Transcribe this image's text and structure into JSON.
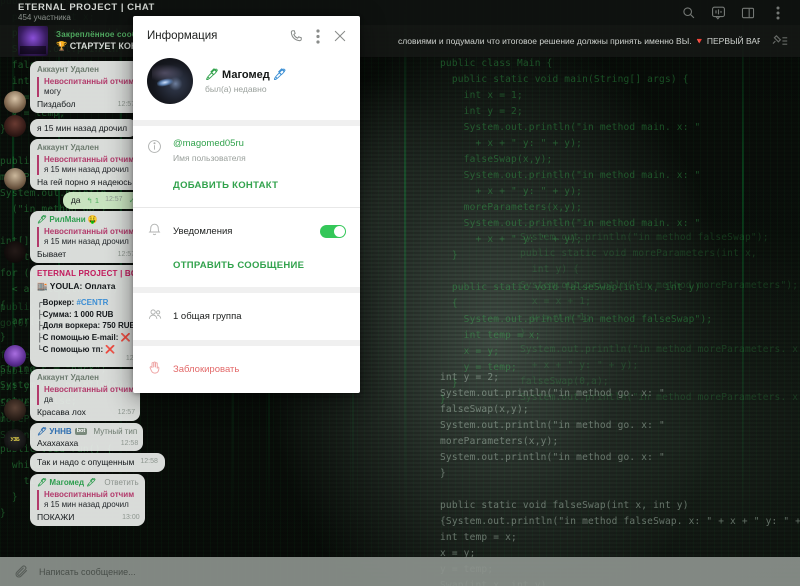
{
  "header": {
    "title": "ETERNAL PROJECT | CHAT",
    "subtitle": "454 участника",
    "icons": [
      {
        "name": "search-icon"
      },
      {
        "name": "voice-chat-icon"
      },
      {
        "name": "split-view-icon"
      },
      {
        "name": "more-options-icon"
      }
    ]
  },
  "pinned": {
    "label": "Закреплённое сообщение",
    "text": "🏆 СТАРТУЕТ КОНКУРС НА",
    "overflow_text": "словиями и подумали что итоговое решение должны принять именно ВЫ. 🔻 ПЕРВЫЙ ВАРИАНТ",
    "pin_icon": "pinned-messages-icon"
  },
  "messages": [
    {
      "id": "m1",
      "sender": "Аккаунт Удален",
      "sender_color": "grey",
      "quote_name": "Невоспитанный отчим",
      "quote_text": "могу",
      "text": "Пиздабол",
      "time": "12:57",
      "avatar": "a1",
      "out": false
    },
    {
      "id": "m2",
      "sender": "",
      "sender_color": "grey",
      "quote_name": "",
      "quote_text": "",
      "text": "я 15 мин назад дрочил",
      "time": "",
      "avatar": "a2",
      "out": false
    },
    {
      "id": "m3",
      "sender": "Аккаунт Удален",
      "sender_color": "grey",
      "quote_name": "Невоспитанный отчим",
      "quote_text": "я 15 мин назад дрочил",
      "text": "На гей порно я надеюсь",
      "time": "",
      "avatar": "a3",
      "out": false
    },
    {
      "id": "m4",
      "sender": "",
      "sender_color": "grey",
      "quote_name": "",
      "quote_text": "",
      "text": "да",
      "time": "12:57",
      "reply_count": "1",
      "checks": "✓✓",
      "avatar": "",
      "out": true
    },
    {
      "id": "m5",
      "sender": "🖊 РилМани 🤑",
      "sender_color": "green",
      "quote_name": "Невоспитанный отчим",
      "quote_text": "я 15 мин назад дрочил",
      "text": "Бывает",
      "time": "12:57",
      "avatar": "a4",
      "out": false
    },
    {
      "id": "m6",
      "bot": true,
      "bot_title": "ETERNAL PROJECT | BOT",
      "bot_sub": "🏬 YOULA: Оплата",
      "bot_lines": [
        {
          "prefix": "┌Воркер: ",
          "value": "#CENTR",
          "highlight": true
        },
        {
          "prefix": "├Сумма: ",
          "value": "1 000 RUB",
          "highlight": false
        },
        {
          "prefix": "├Доля воркера: ",
          "value": "750 RUB",
          "highlight": false
        },
        {
          "prefix": "├С помощью E-mail: ",
          "value": "❌",
          "highlight": false
        },
        {
          "prefix": "└С помощью тп: ",
          "value": "❌",
          "highlight": false
        }
      ],
      "time": "12:57",
      "avatar": "a5",
      "out": false
    },
    {
      "id": "m7",
      "sender": "Аккаунт Удален",
      "sender_color": "grey",
      "quote_name": "Невоспитанный отчим",
      "quote_text": "да",
      "text": "Красава лох",
      "time": "12:57",
      "avatar": "a6",
      "out": false
    },
    {
      "id": "m8",
      "sender": "🖊 УННВ",
      "sender_badge": "bot",
      "sender_color": "blue",
      "sender_suffix": "Мутный тип",
      "quote_name": "",
      "quote_text": "",
      "text": "Ахахахаха",
      "time": "12:58",
      "avatar": "a7",
      "out": false
    },
    {
      "id": "m9",
      "sender": "",
      "sender_color": "grey",
      "quote_name": "",
      "quote_text": "",
      "text": "Так и надо с опущенным",
      "time": "12:58",
      "avatar": "",
      "out": false
    },
    {
      "id": "m10",
      "sender": "🖊 Магомед 🖊",
      "sender_color": "green",
      "sender_action": "Ответить",
      "quote_name": "Невоспитанный отчим",
      "quote_text": "я 15 мин назад дрочил",
      "text": "ПОКАЖИ",
      "time": "13:00",
      "avatar": "",
      "out": false
    }
  ],
  "composer": {
    "attach_icon": "paperclip-icon",
    "placeholder": "Написать сообщение..."
  },
  "dialog": {
    "title": "Информация",
    "call_icon": "phone-call-icon",
    "menu_icon": "more-vertical-icon",
    "close_icon": "close-icon",
    "profile": {
      "avatar_name": "user-avatar",
      "name": "Магомед",
      "emoji_before": "🖊",
      "emoji_after": "🖊",
      "status": "был(а) недавно"
    },
    "username_section": {
      "icon": "info-icon",
      "username": "@magomed05ru",
      "caption": "Имя пользователя"
    },
    "add_contact_label": "ДОБАВИТЬ КОНТАКТ",
    "notifications": {
      "icon": "bell-icon",
      "label": "Уведомления",
      "toggle_on": true
    },
    "send_message_label": "ОТПРАВИТЬ СООБЩЕНИЕ",
    "groups": {
      "icon": "people-icon",
      "label": "1 общая группа"
    },
    "block": {
      "icon": "block-hand-icon",
      "label": "Заблокировать"
    }
  },
  "colors": {
    "accent_green": "#31a24c",
    "danger_red": "#e36a6a",
    "pin_green": "#4fa85f",
    "quote_pink": "#b23a6b"
  },
  "background_code": {
    "c1": "public class Main {\n  private int x;\n  public static void\n  System.out.println\n  falseSwap(x,y);\n  int temp = x;\n  x = y;\n  y = temp;\n}\n\npublic static void\nmoreParameters(x,y);\nSystem.out.println\n  (\"in method go\")\n\nint[] arr = new\n  int[10];\nfor (int i = 0; i\n  < arr.length; i++)\n{\n  arr[i] = i * 2;\n}\n\nString s = \"hack\";\nSystem.out.println(s);\nreturn false;\n}\n\npublic void run() {\n  while (true) {\n    tick();\n  }\n}",
    "c2": "public class Main {\n  public static void main(String[] args) {\n    int x = 1;\n    int y = 2;\n    System.out.println(\"in method main. x: \"\n      + x + \" y: \" + y);\n    falseSwap(x,y);\n    System.out.println(\"in method main. x: \"\n      + x + \" y: \" + y);\n    moreParameters(x,y);\n    System.out.println(\"in method main. x: \"\n      + x + \" y: \" + y);\n  }\n\n  public static void falseSwap(int x, int y)\n  {\n    System.out.println(\"in method falseSwap\");\n    int temp = x;\n    x = y;\n    y = temp;\n  }\n}",
    "c3": "System.out.println(\"in method falseSwap\");\npublic static void moreParameters(int x,\n  int y) {\nSystem.out.println(\"in method moreParameters\");\n  x = x + 1;\n  y = y + 1;\n}\nSystem.out.println(\"in method moreParameters. x: \"\n  + x + \" y: \" + y);\nfalseSwap(0,a);\nSystem.out.println(\"in method moreParameters. x: \"",
    "c4": "int y = 2;\nSystem.out.println(\"in method go. x: \"\nfalseSwap(x,y);\nSystem.out.println(\"in method go. x: \"\nmoreParameters(x,y);\nSystem.out.println(\"in method go. x: \"\n}\n\npublic static void falseSwap(int x, int y)\n{System.out.println(\"in method falseSwap. x: \" + x + \" y: \" + y);\nint temp = x;\nx = y;\ny = temp;\nSwap(int x, int y)",
    "c5": "public\ngo(0)\n\nfalse\npublic\nint y;\nSystem\nmoreP\nString"
  }
}
